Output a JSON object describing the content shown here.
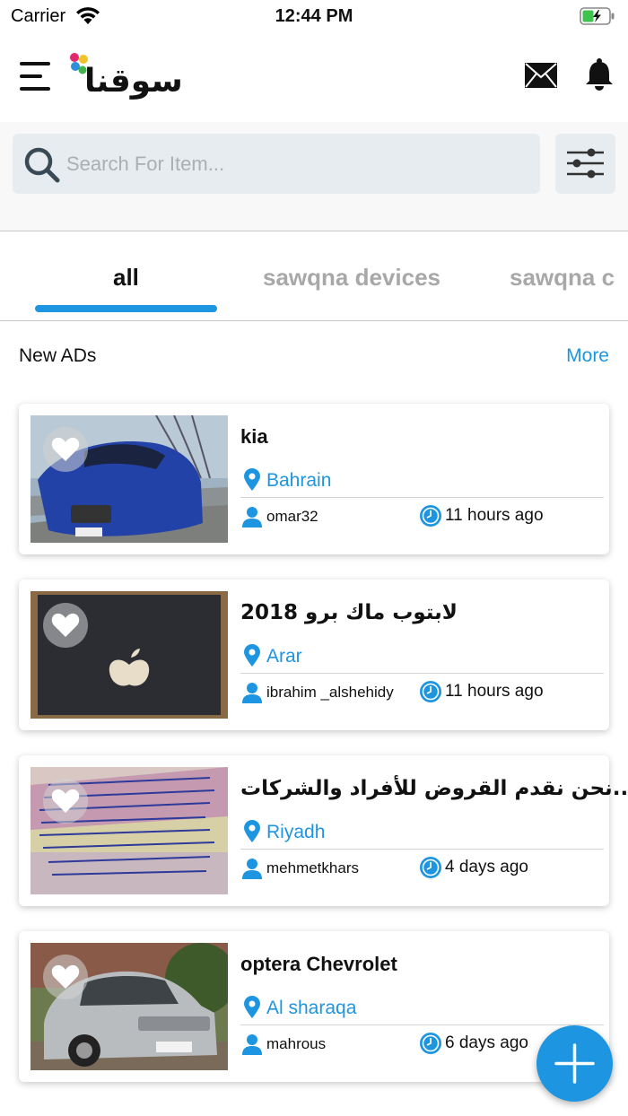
{
  "status_bar": {
    "carrier": "Carrier",
    "time": "12:44 PM"
  },
  "app_bar": {
    "logo_text": "سوقنا",
    "logo_dot_colors": [
      "#e0296f",
      "#f2c229",
      "#2f8fd8",
      "#3fb54c"
    ]
  },
  "search": {
    "placeholder": "Search For Item..."
  },
  "tabs": [
    {
      "label": "all",
      "active": true
    },
    {
      "label": "sawqna devices",
      "active": false
    },
    {
      "label": "sawqna c",
      "active": false
    }
  ],
  "section": {
    "title": "New ADs",
    "more_label": "More"
  },
  "ads": [
    {
      "title": "kia",
      "location": "Bahrain",
      "user": "omar32",
      "time": "11 hours ago",
      "image": "car-blue"
    },
    {
      "title": "لابتوب ماك برو 2018",
      "location": "Arar",
      "user": "ibrahim _alshehidy",
      "time": "11 hours ago",
      "image": "laptop"
    },
    {
      "title": "نحن نقدم القروض للأفراد والشركات....",
      "location": "Riyadh",
      "user": "mehmetkhars",
      "time": "4 days ago",
      "image": "document"
    },
    {
      "title": "optera Chevrolet",
      "location": "Al sharaqa",
      "user": "mahrous",
      "time": "6 days ago",
      "image": "car-silver"
    }
  ],
  "colors": {
    "accent": "#1e95e0",
    "search_bg": "#e6ecef",
    "tab_inactive": "#a8a8a8"
  },
  "icons": {
    "menu": "hamburger-icon",
    "mail": "envelope-icon",
    "bell": "bell-icon",
    "search": "search-icon",
    "filter": "sliders-icon",
    "favorite": "heart-icon",
    "location": "pin-icon",
    "user": "person-icon",
    "time": "clock-icon",
    "add": "plus-icon"
  }
}
